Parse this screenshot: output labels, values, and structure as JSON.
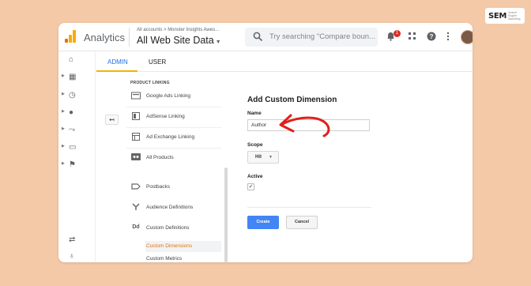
{
  "brand": {
    "main": "SEM",
    "sub": "Search Engine Marketing"
  },
  "header": {
    "app_title": "Analytics",
    "breadcrumb": "All accounts > Monster Insights Awes...",
    "property": "All Web Site Data",
    "search_placeholder": "Try searching \"Compare boun...",
    "notification_count": "1"
  },
  "tabs": {
    "admin": "ADMIN",
    "user": "USER"
  },
  "menu": {
    "heading": "PRODUCT LINKING",
    "items": [
      {
        "label": "Google Ads Linking"
      },
      {
        "label": "AdSense Linking"
      },
      {
        "label": "Ad Exchange Linking"
      },
      {
        "label": "All Products"
      },
      {
        "label": "Postbacks"
      },
      {
        "label": "Audience Definitions"
      },
      {
        "label": "Custom Definitions"
      }
    ],
    "subitems": [
      {
        "label": "Custom Dimensions",
        "active": true
      },
      {
        "label": "Custom Metrics",
        "active": false
      }
    ],
    "custom_definitions_icon": "Dd"
  },
  "form": {
    "title": "Add Custom Dimension",
    "name_label": "Name",
    "name_value": "Author",
    "scope_label": "Scope",
    "scope_value": "Hit",
    "active_label": "Active",
    "active_checked": true,
    "create_label": "Create",
    "cancel_label": "Cancel"
  },
  "colors": {
    "background": "#f4c9a8",
    "accent_blue": "#1a73e8",
    "active_orange": "#e8710a",
    "annotation_red": "#e0201b",
    "create_button": "#4285f4"
  },
  "icons": {
    "rail": [
      "home-icon",
      "dashboard-icon",
      "clock-icon",
      "person-icon",
      "acquisition-icon",
      "display-icon",
      "flag-icon",
      "discover-icon",
      "lightbulb-icon"
    ]
  }
}
